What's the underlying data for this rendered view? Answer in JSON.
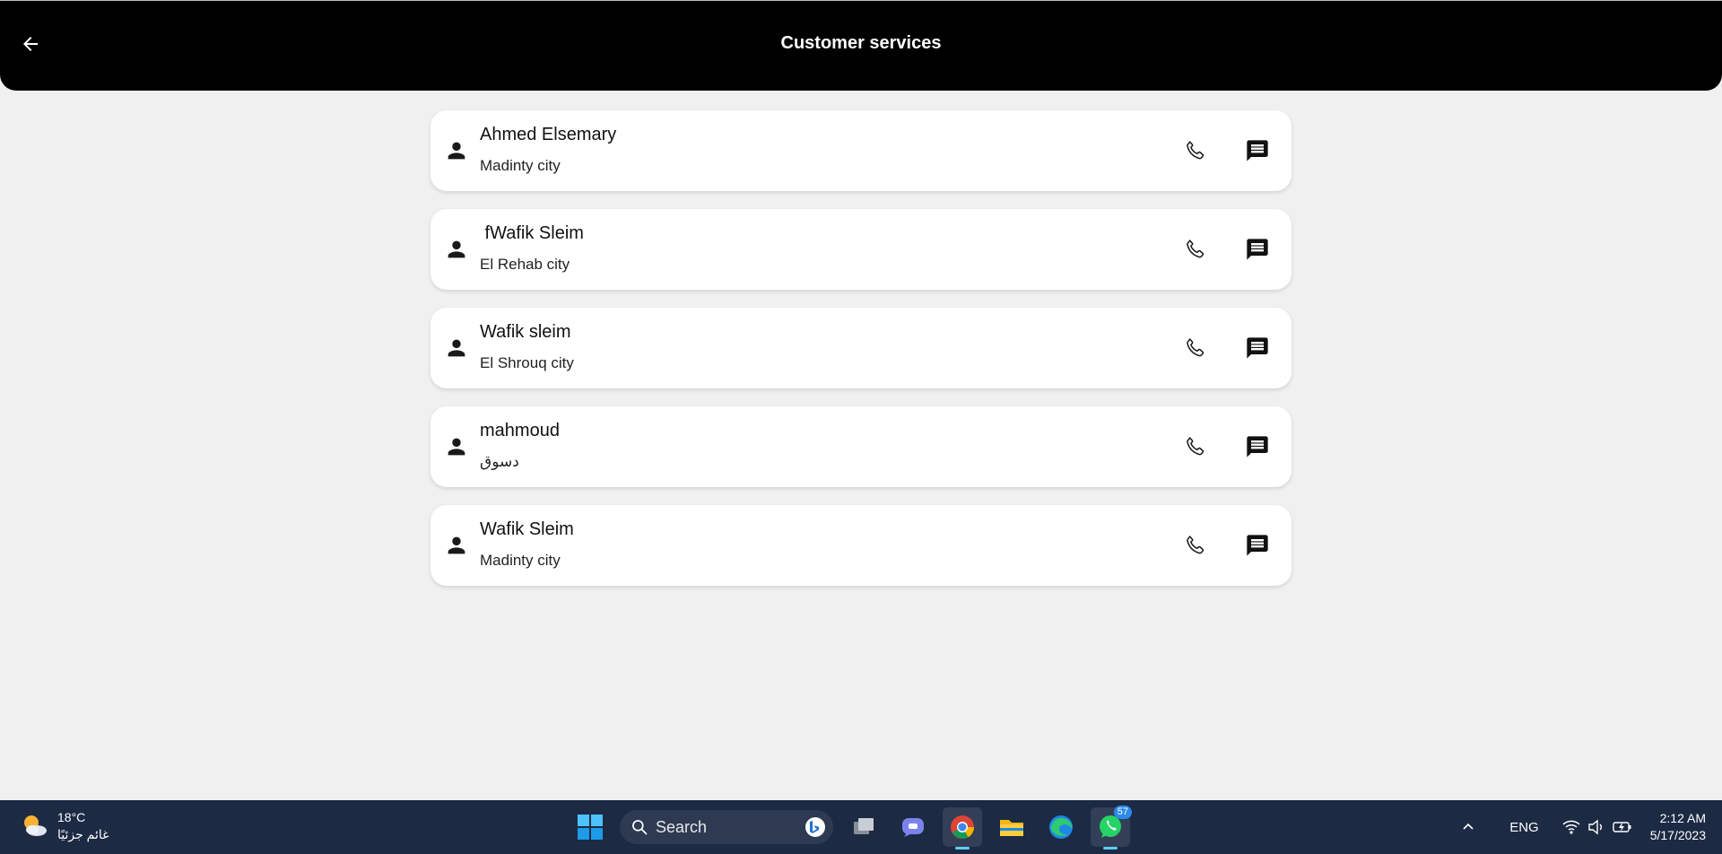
{
  "appbar": {
    "title": "Customer services"
  },
  "customers": [
    {
      "name": "Ahmed Elsemary",
      "city": "Madinty city"
    },
    {
      "name": " fWafik Sleim",
      "city": "El Rehab city"
    },
    {
      "name": "Wafik sleim",
      "city": "El Shrouq city"
    },
    {
      "name": "mahmoud",
      "city": "دسوق"
    },
    {
      "name": "Wafik Sleim",
      "city": "Madinty city"
    }
  ],
  "icons": {
    "back": "arrow-back-icon",
    "person": "person-icon",
    "phone": "phone-icon",
    "message": "message-icon"
  },
  "colors": {
    "appbar_bg": "#000000",
    "page_bg": "#f0f0f0",
    "card_bg": "#ffffff",
    "taskbar_bg": "#1c2a44"
  },
  "taskbar": {
    "weather_temp": "18°C",
    "weather_desc": "غائم جزئيًا",
    "search_label": "Search",
    "whatsapp_badge": "57",
    "language": "ENG",
    "time": "2:12 AM",
    "date": "5/17/2023"
  }
}
